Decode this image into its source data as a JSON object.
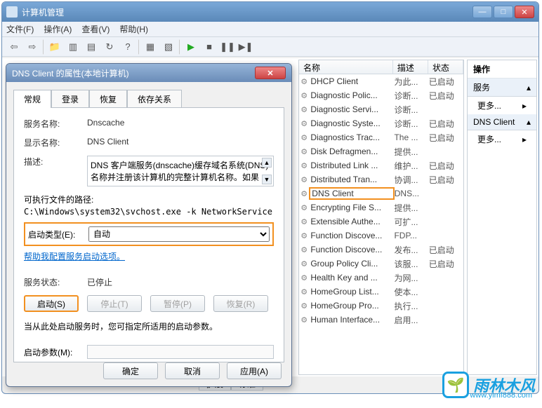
{
  "window": {
    "title": "计算机管理",
    "menu": [
      "文件(F)",
      "操作(A)",
      "查看(V)",
      "帮助(H)"
    ]
  },
  "columns": {
    "name": "名称",
    "desc": "描述",
    "status": "状态"
  },
  "services": [
    {
      "name": "DHCP Client",
      "desc": "为此...",
      "status": "已启动"
    },
    {
      "name": "Diagnostic Polic...",
      "desc": "诊断...",
      "status": "已启动"
    },
    {
      "name": "Diagnostic Servi...",
      "desc": "诊断...",
      "status": ""
    },
    {
      "name": "Diagnostic Syste...",
      "desc": "诊断...",
      "status": "已启动"
    },
    {
      "name": "Diagnostics Trac...",
      "desc": "The ...",
      "status": "已启动"
    },
    {
      "name": "Disk Defragmen...",
      "desc": "提供...",
      "status": ""
    },
    {
      "name": "Distributed Link ...",
      "desc": "维护...",
      "status": "已启动"
    },
    {
      "name": "Distributed Tran...",
      "desc": "协调...",
      "status": "已启动"
    },
    {
      "name": "DNS Client",
      "desc": "DNS...",
      "status": ""
    },
    {
      "name": "Encrypting File S...",
      "desc": "提供...",
      "status": ""
    },
    {
      "name": "Extensible Authe...",
      "desc": "可扩...",
      "status": ""
    },
    {
      "name": "Function Discove...",
      "desc": "FDP...",
      "status": ""
    },
    {
      "name": "Function Discove...",
      "desc": "发布...",
      "status": "已启动"
    },
    {
      "name": "Group Policy Cli...",
      "desc": "该服...",
      "status": "已启动"
    },
    {
      "name": "Health Key and ...",
      "desc": "为网...",
      "status": ""
    },
    {
      "name": "HomeGroup List...",
      "desc": "使本...",
      "status": ""
    },
    {
      "name": "HomeGroup Pro...",
      "desc": "执行...",
      "status": ""
    },
    {
      "name": "Human Interface...",
      "desc": "启用...",
      "status": ""
    }
  ],
  "selected_index": 8,
  "actions": {
    "title": "操作",
    "service_header": "服务",
    "more": "更多...",
    "current": "DNS Client"
  },
  "bottom_tabs": [
    "扩展",
    "标准"
  ],
  "dialog": {
    "title": "DNS Client 的属性(本地计算机)",
    "tabs": [
      "常规",
      "登录",
      "恢复",
      "依存关系"
    ],
    "active_tab": 0,
    "labels": {
      "service_name": "服务名称:",
      "display_name": "显示名称:",
      "description": "描述:",
      "exe_path": "可执行文件的路径:",
      "startup_type": "启动类型(E):",
      "help_link": "帮助我配置服务启动选项。",
      "service_status": "服务状态:",
      "start_note": "当从此处启动服务时，您可指定所适用的启动参数。",
      "start_params": "启动参数(M):"
    },
    "values": {
      "service_name": "Dnscache",
      "display_name": "DNS Client",
      "description": "DNS 客户端服务(dnscache)缓存域名系统(DNS)名称并注册该计算机的完整计算机名称。如果",
      "exe_path": "C:\\Windows\\system32\\svchost.exe -k NetworkService",
      "startup_type": "自动",
      "service_status": "已停止",
      "start_params": ""
    },
    "buttons": {
      "start": "启动(S)",
      "stop": "停止(T)",
      "pause": "暂停(P)",
      "resume": "恢复(R)",
      "ok": "确定",
      "cancel": "取消",
      "apply": "应用(A)"
    }
  },
  "watermark": {
    "text": "雨林木风",
    "url": "www.ylmf888.com"
  }
}
